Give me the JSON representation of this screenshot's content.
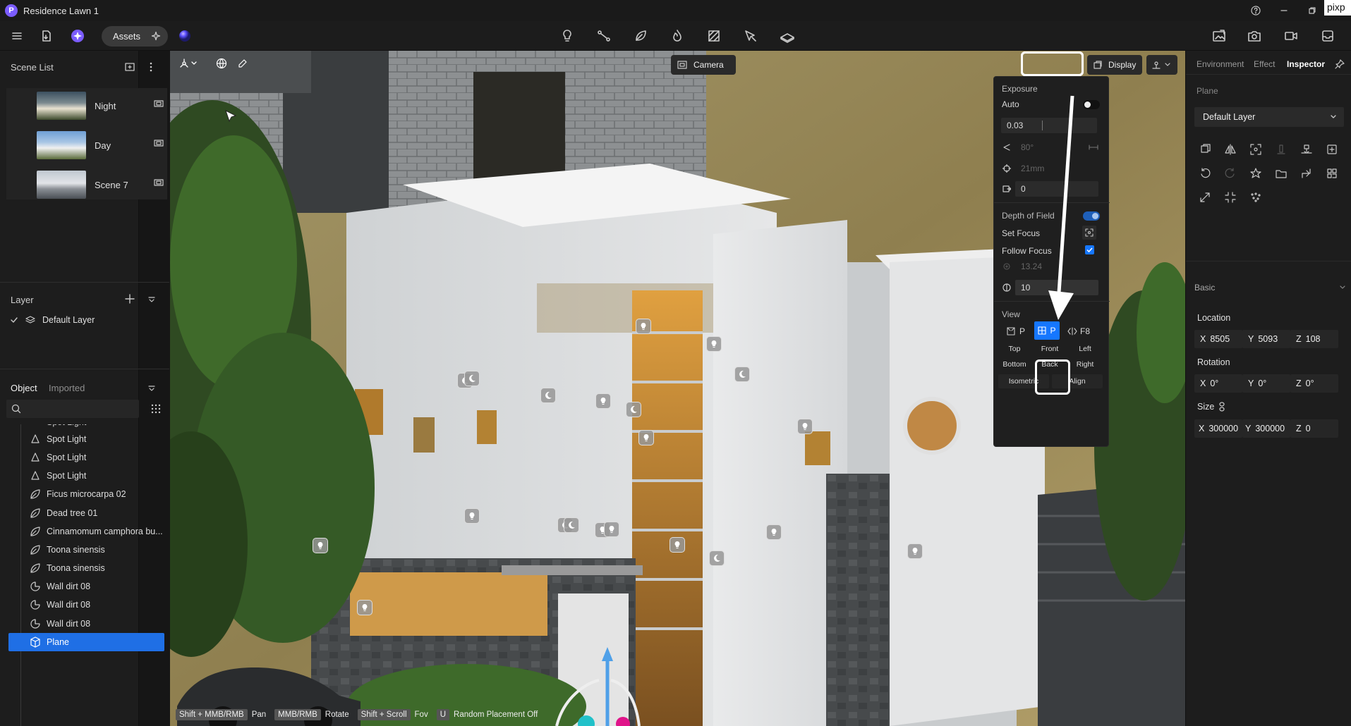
{
  "window": {
    "title": "Residence Lawn 1",
    "logo_letter": "P",
    "corner_tag": "pixp"
  },
  "toolbar": {
    "assets_label": "Assets"
  },
  "scene_list": {
    "title": "Scene List",
    "items": [
      {
        "label": "Night"
      },
      {
        "label": "Day"
      },
      {
        "label": "Scene 7"
      }
    ]
  },
  "layer": {
    "title": "Layer",
    "items": [
      {
        "label": "Default Layer"
      }
    ]
  },
  "objects": {
    "tab_object": "Object",
    "tab_imported": "Imported",
    "search_placeholder": "",
    "partial_item": "Spot Light",
    "items": [
      {
        "label": "Spot Light",
        "icon": "spot-light-icon"
      },
      {
        "label": "Spot Light",
        "icon": "spot-light-icon"
      },
      {
        "label": "Spot Light",
        "icon": "spot-light-icon"
      },
      {
        "label": "Ficus microcarpa 02",
        "icon": "leaf-icon"
      },
      {
        "label": "Dead tree 01",
        "icon": "leaf-icon"
      },
      {
        "label": "Cinnamomum camphora bu...",
        "icon": "leaf-icon"
      },
      {
        "label": "Toona sinensis",
        "icon": "leaf-icon"
      },
      {
        "label": "Toona sinensis",
        "icon": "leaf-icon"
      },
      {
        "label": "Wall dirt 08",
        "icon": "decal-icon"
      },
      {
        "label": "Wall dirt 08",
        "icon": "decal-icon"
      },
      {
        "label": "Wall dirt 08",
        "icon": "decal-icon"
      },
      {
        "label": "Plane",
        "icon": "cube-icon"
      }
    ],
    "selected": "Plane"
  },
  "viewport_top": {
    "camera_label": "Camera",
    "display_label": "Display"
  },
  "camera_panel": {
    "exposure_label": "Exposure",
    "auto_label": "Auto",
    "exposure_value": "0.03",
    "fov_value": "80°",
    "focal_value": "21mm",
    "shift_value": "0",
    "dof_label": "Depth of Field",
    "set_focus_label": "Set Focus",
    "follow_focus_label": "Follow Focus",
    "focus_distance": "13.24",
    "aperture_value": "10",
    "view_label": "View",
    "proj_p1": "P",
    "proj_p2": "P",
    "proj_f8": "F8",
    "views": [
      "Top",
      "Front",
      "Left",
      "Bottom",
      "Back",
      "Right",
      "Isometric",
      "Align"
    ]
  },
  "right_panel": {
    "tabs": [
      "Environment",
      "Effect",
      "Inspector"
    ],
    "active_tab": "Inspector",
    "object_type": "Plane",
    "layer_select": "Default Layer",
    "basic_label": "Basic",
    "location_label": "Location",
    "location": {
      "x": "8505",
      "y": "5093",
      "z": "108"
    },
    "rotation_label": "Rotation",
    "rotation": {
      "x": "0°",
      "y": "0°",
      "z": "0°"
    },
    "size_label": "Size",
    "size": {
      "x": "300000",
      "y": "300000",
      "z": "0"
    }
  },
  "hints": [
    {
      "key": "Shift + MMB/RMB",
      "text": "Pan"
    },
    {
      "key": "MMB/RMB",
      "text": "Rotate"
    },
    {
      "key": "Shift + Scroll",
      "text": "Fov"
    },
    {
      "key": "U",
      "text": "Random Placement Off"
    }
  ],
  "colors": {
    "accent": "#1677ff",
    "selection": "#1f6fe5",
    "panel": "#1d1d1d"
  }
}
